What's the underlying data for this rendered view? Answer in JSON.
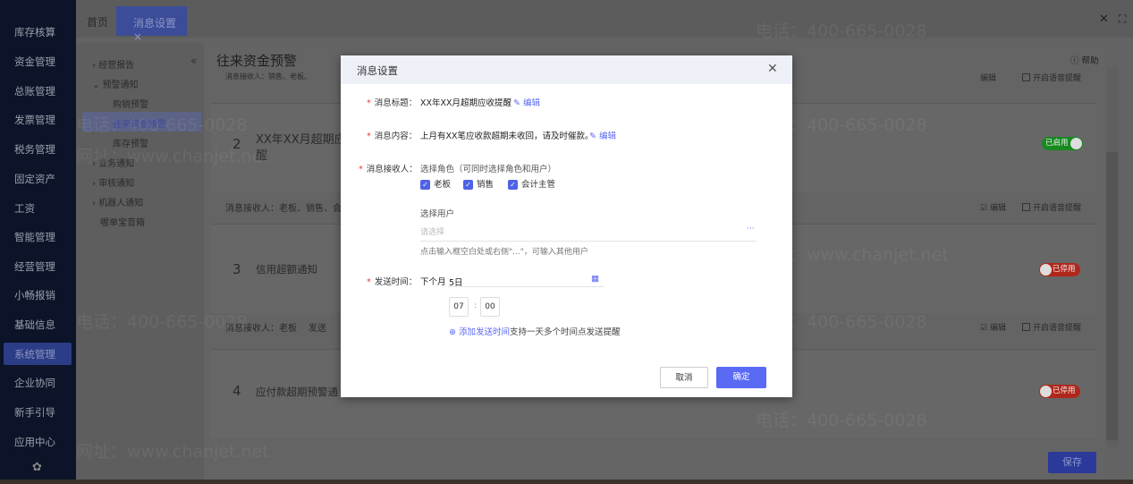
{
  "sidebar": {
    "items": [
      "库存核算",
      "资金管理",
      "总账管理",
      "发票管理",
      "税务管理",
      "固定资产",
      "工资",
      "智能管理",
      "经营管理",
      "小畅报销",
      "基础信息",
      "系统管理",
      "企业协同",
      "新手引导",
      "应用中心"
    ],
    "active": "系统管理",
    "settings_icon": "gear-icon"
  },
  "tabs": {
    "home": "首页",
    "active": "消息设置",
    "close": "×"
  },
  "tree": {
    "items": [
      "经营报告",
      "预警通知",
      "购销预警",
      "往来资金预警",
      "库存预警",
      "业务通知",
      "审核通知",
      "机器人通知",
      "喔单宝音箱"
    ],
    "collapse": "«"
  },
  "page": {
    "title": "往来资金预警",
    "help": "帮助",
    "save": "保存"
  },
  "cards": [
    {
      "num": "2",
      "title": "XX年XX月超期应收提",
      "title2": "醒",
      "status": "已启用",
      "receivers": "消息接收人：老板、销售、会",
      "edit": "编辑",
      "voice": "开启语音提醒"
    },
    {
      "num": "3",
      "title": "信用超额通知",
      "status": "已停用",
      "receivers": "消息接收人：老板",
      "send": "发送",
      "edit": "编辑",
      "voice": "开启语音提醒"
    },
    {
      "num": "4",
      "title": "应付款超期预警通",
      "status": "已停用",
      "edit": "编辑",
      "voice": "开启语音提醒"
    }
  ],
  "top_receivers": "消息接收人：销售、老板、",
  "watermark": {
    "phone": "电话：400-665-0028",
    "site": "网址：www.chanjet.net"
  },
  "modal": {
    "title": "消息设置",
    "fields": {
      "title_label": "消息标题：",
      "title_value": "XX年XX月超期应收提醒",
      "content_label": "消息内容：",
      "content_value": "上月有XX笔应收款超期未收回，请及时催款。",
      "edit": "编辑",
      "recv_label": "消息接收人：",
      "role_hint": "选择角色（可同时选择角色和用户）",
      "roles": [
        {
          "label": "老板",
          "checked": true
        },
        {
          "label": "销售",
          "checked": true
        },
        {
          "label": "会计主管",
          "checked": true
        }
      ],
      "user_label": "选择用户",
      "user_placeholder": "请选择",
      "user_more": "···",
      "user_hint": "点击输入框空白处或右侧\"...\"，可输入其他用户",
      "time_label": "发送时间：",
      "time_prefix": "下个月",
      "day": "5日",
      "hour": "07",
      "minute": "00",
      "add_time": "添加发送时间",
      "add_hint": "支持一天多个时间点发送提醒"
    },
    "cancel": "取消",
    "confirm": "确定"
  },
  "colors": {
    "primary": "#5a6af5",
    "required": "#e23c3c",
    "enabled": "#16891f",
    "disabled": "#b0271b"
  }
}
